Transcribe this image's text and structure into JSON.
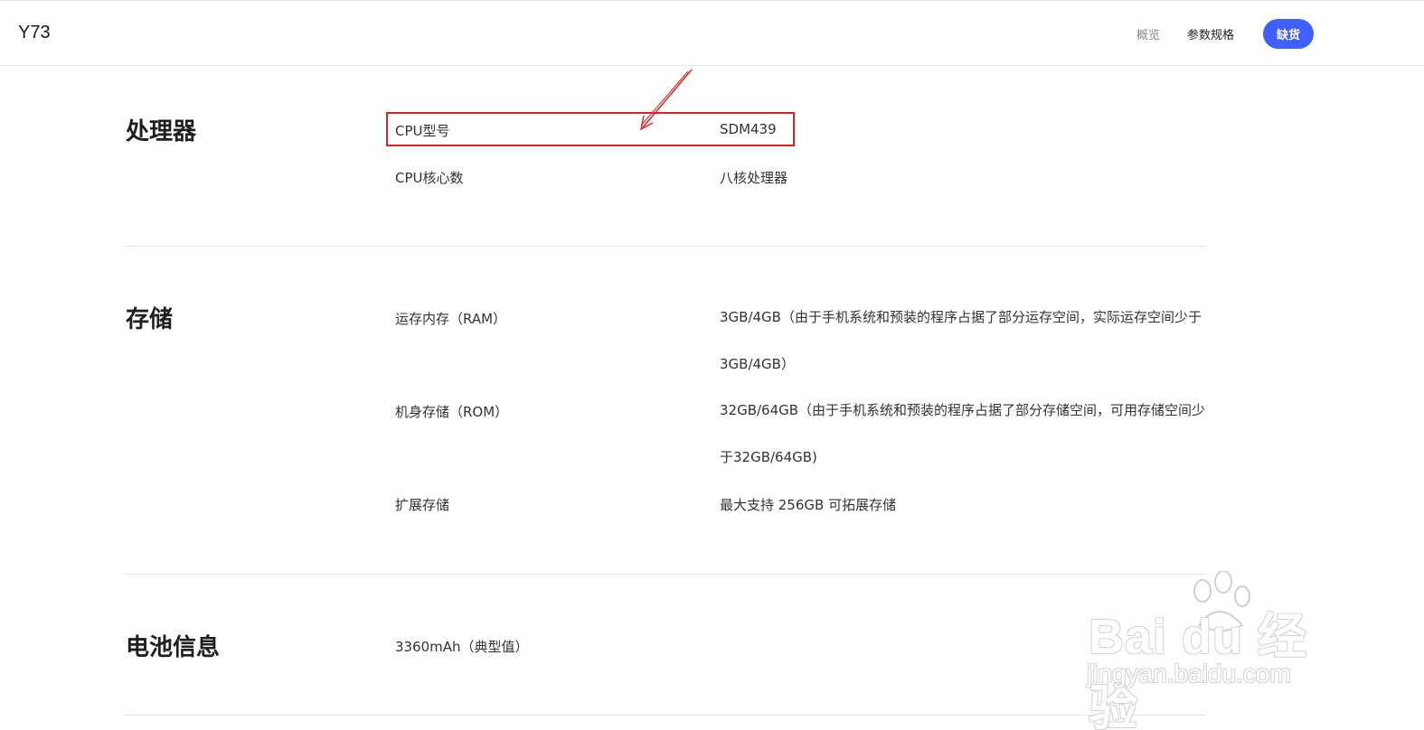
{
  "header": {
    "product_name": "Y73",
    "nav": {
      "overview": "概览",
      "specs": "参数规格"
    },
    "buy_button": "缺货",
    "accent_color": "#415fff"
  },
  "sections": {
    "processor": {
      "title": "处理器",
      "rows": [
        {
          "label": "CPU型号",
          "value": "SDM439"
        },
        {
          "label": "CPU核心数",
          "value": "八核处理器"
        }
      ]
    },
    "storage": {
      "title": "存储",
      "rows": [
        {
          "label": "运存内存（RAM）",
          "value": "3GB/4GB（由于手机系统和预装的程序占据了部分运存空间，实际运存空间少于3GB/4GB）"
        },
        {
          "label": "机身存储（ROM）",
          "value": "32GB/64GB（由于手机系统和预装的程序占据了部分存储空间，可用存储空间少于32GB/64GB)"
        },
        {
          "label": "扩展存储",
          "value": "最大支持 256GB 可拓展存储"
        }
      ]
    },
    "battery": {
      "title": "电池信息",
      "rows": [
        {
          "label": "3360mAh（典型值）"
        }
      ]
    }
  },
  "annotation": {
    "highlight_color": "#e02020"
  },
  "watermark": {
    "logo": "Bai du 经验",
    "url": "jingyan.baidu.com"
  }
}
